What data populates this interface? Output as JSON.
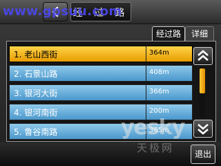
{
  "header": {
    "title": "经 过 路",
    "watermark": "www.gpsuu.com",
    "back_icon": "back-arrow-icon"
  },
  "tabs": [
    {
      "label": "经过路",
      "active": true
    },
    {
      "label": "详细",
      "active": false
    }
  ],
  "route_list": {
    "rows": [
      {
        "index_name": "1. 老山西街",
        "distance": "364m",
        "selected": true
      },
      {
        "index_name": "2. 石景山路",
        "distance": "408m",
        "selected": false
      },
      {
        "index_name": "3. 银河大街",
        "distance": "366m",
        "selected": false
      },
      {
        "index_name": "4. 银河南街",
        "distance": "200m",
        "selected": false
      },
      {
        "index_name": "5. 鲁谷南路",
        "distance": "365m",
        "selected": false
      }
    ]
  },
  "scrollbar": {
    "up_icon": "double-chevron-up-icon",
    "down_icon": "double-chevron-down-icon",
    "position": 0.0,
    "thumb_color": "#f3b31a"
  },
  "footer": {
    "exit_label": "退出",
    "watermark_en": "yesky",
    "watermark_cn": "天极网"
  },
  "colors": {
    "selected_row": "#f4b91e",
    "normal_row": "#6fb3e0",
    "background": "#2a2a2a"
  }
}
